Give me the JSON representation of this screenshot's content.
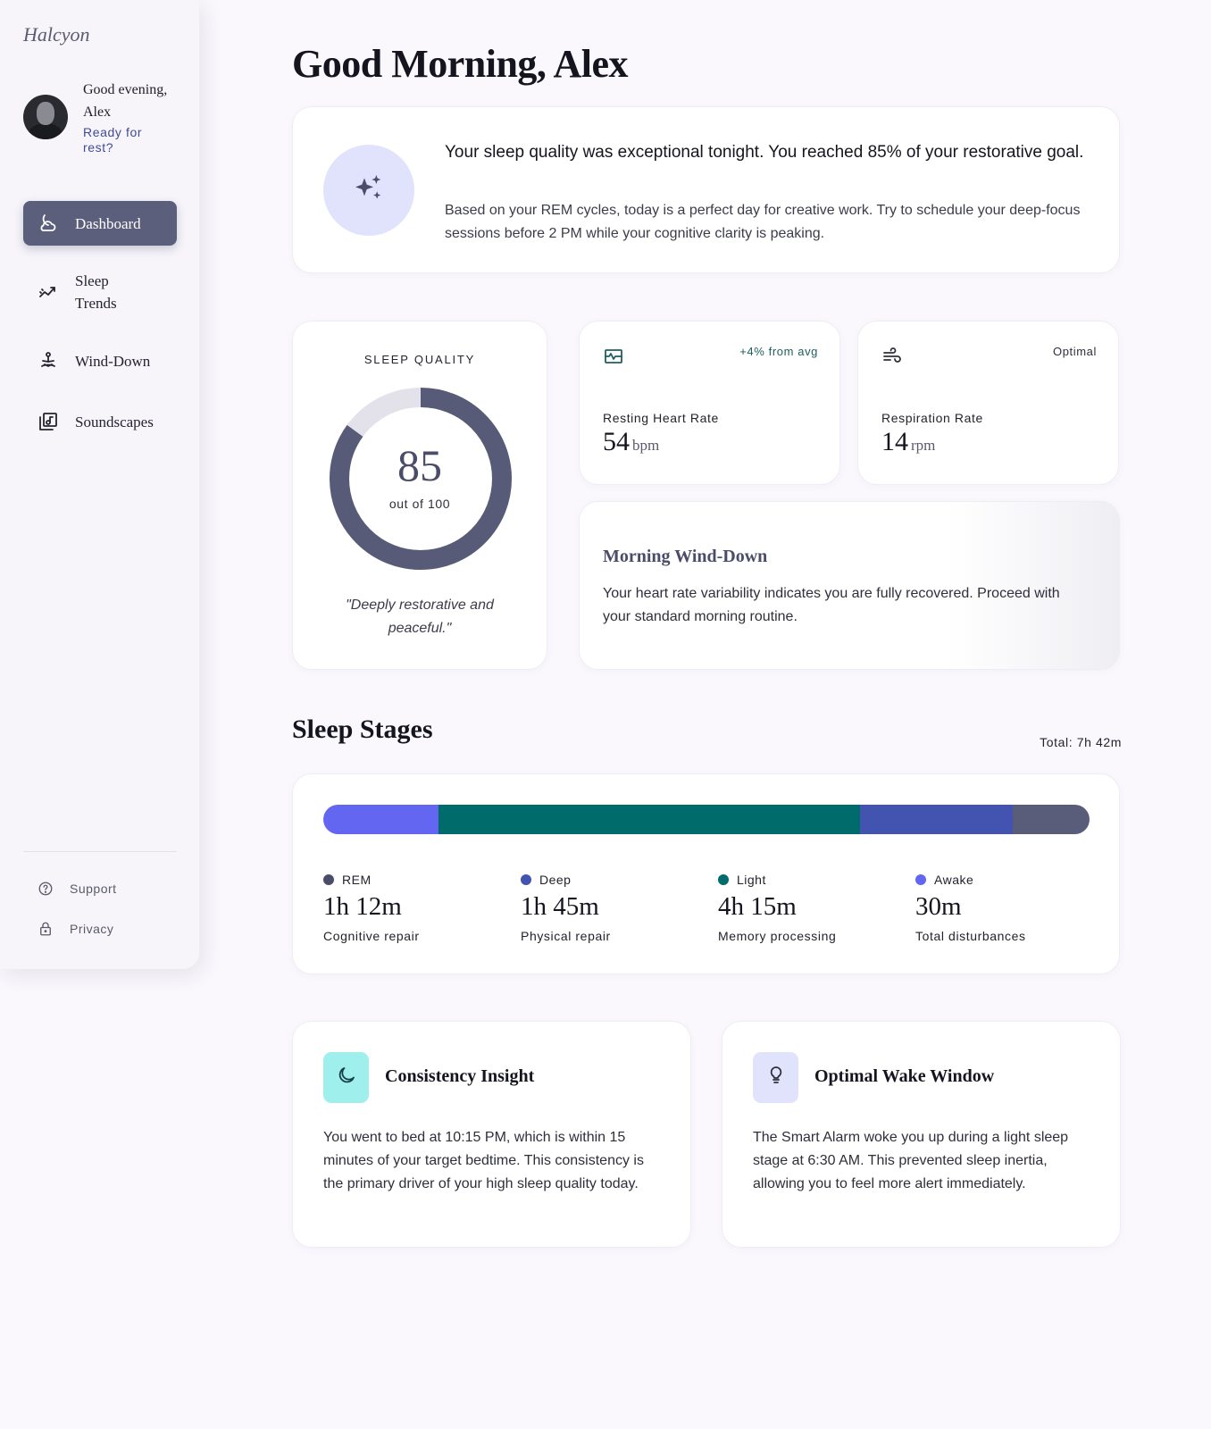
{
  "sidebar": {
    "brand": "Halcyon",
    "greeting": "Good evening, Alex",
    "subtitle": "Ready for rest?",
    "nav": [
      {
        "label": "Dashboard",
        "icon": "moon-cloud-icon",
        "active": true
      },
      {
        "label": "Sleep Trends",
        "icon": "trend-chart-icon"
      },
      {
        "label": "Wind-Down",
        "icon": "meditation-icon"
      },
      {
        "label": "Soundscapes",
        "icon": "music-library-icon"
      }
    ],
    "footer": [
      {
        "label": "Support",
        "icon": "help-circle-icon"
      },
      {
        "label": "Privacy",
        "icon": "lock-icon"
      }
    ]
  },
  "header": {
    "title": "Good Morning, Alex"
  },
  "hero": {
    "icon": "sparkles-icon",
    "headline": "Your sleep quality was exceptional tonight. You reached 85% of your restorative goal.",
    "body": "Based on your REM cycles, today is a perfect day for creative work. Try to schedule your deep-focus sessions before 2 PM while your cognitive clarity is peaking."
  },
  "sleep_quality": {
    "label": "SLEEP QUALITY",
    "score": "85",
    "score_fraction": 0.85,
    "out_of": "out of 100",
    "quote": "\"Deeply restorative and peaceful.\""
  },
  "metrics": [
    {
      "icon": "heart-monitor-icon",
      "badge": "+4% from avg",
      "badge_color": "#1f5e5e",
      "label": "Resting Heart Rate",
      "value": "54",
      "unit": "bpm"
    },
    {
      "icon": "wind-icon",
      "badge": "Optimal",
      "badge_color": "#2e2f3b",
      "label": "Respiration Rate",
      "value": "14",
      "unit": "rpm"
    }
  ],
  "wind_down": {
    "title": "Morning Wind-Down",
    "body": "Your heart rate variability indicates you are fully recovered. Proceed with your standard morning routine."
  },
  "sleep_stages": {
    "title": "Sleep Stages",
    "total": "Total: 7h 42m",
    "bar_segments": [
      {
        "color": "#6366f1",
        "fraction": 0.15
      },
      {
        "color": "#006b6b",
        "fraction": 0.55
      },
      {
        "color": "#4353b0",
        "fraction": 0.2
      },
      {
        "color": "#5a5d7a",
        "fraction": 0.1
      }
    ],
    "legend": [
      {
        "name": "REM",
        "value": "1h 12m",
        "desc": "Cognitive repair",
        "color": "#4a4d69"
      },
      {
        "name": "Deep",
        "value": "1h 45m",
        "desc": "Physical repair",
        "color": "#4353b0"
      },
      {
        "name": "Light",
        "value": "4h 15m",
        "desc": "Memory processing",
        "color": "#006b6b"
      },
      {
        "name": "Awake",
        "value": "30m",
        "desc": "Total disturbances",
        "color": "#6366f1"
      }
    ]
  },
  "insights": [
    {
      "icon": "moon-icon",
      "icon_bg": "#9ff0ec",
      "title": "Consistency Insight",
      "body": "You went to bed at 10:15 PM, which is within 15 minutes of your target bedtime. This consistency is the primary driver of your high sleep quality today."
    },
    {
      "icon": "lightbulb-icon",
      "icon_bg": "#e1e3fd",
      "title": "Optimal Wake Window",
      "body": "The Smart Alarm woke you up during a light sleep stage at 6:30 AM. This prevented sleep inertia, allowing you to feel more alert immediately."
    }
  ]
}
